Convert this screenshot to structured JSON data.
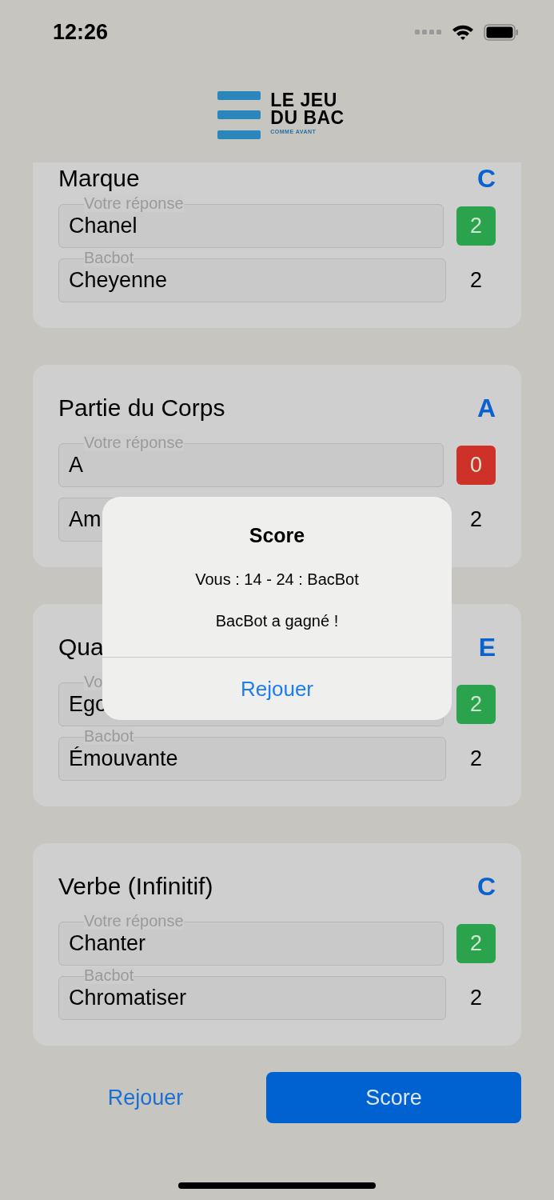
{
  "status_bar": {
    "time": "12:26"
  },
  "logo": {
    "line_1": "LE JEU",
    "line_2": "DU BAC",
    "tagline": "COMME AVANT"
  },
  "categories": [
    {
      "title": "Marque",
      "letter": "C",
      "answers": [
        {
          "label": "Votre réponse",
          "value": "Chanel",
          "score": "2",
          "color": "#2ba24c",
          "kind": "player"
        },
        {
          "label": "Bacbot",
          "value": "Cheyenne",
          "score": "2",
          "kind": "bot"
        }
      ]
    },
    {
      "title": "Partie du Corps",
      "letter": "A",
      "answers": [
        {
          "label": "Votre réponse",
          "value": "A",
          "score": "0",
          "color": "#cd3127",
          "kind": "player"
        },
        {
          "value": "Am",
          "score": "2",
          "kind": "bot"
        }
      ]
    },
    {
      "title": "Qua",
      "letter": "E",
      "answers": [
        {
          "label": "Vo",
          "value": "Ego",
          "score": "2",
          "color": "#2ba24c",
          "kind": "player"
        },
        {
          "label": "Bacbot",
          "value": "Émouvante",
          "score": "2",
          "kind": "bot"
        }
      ]
    },
    {
      "title": "Verbe (Infinitif)",
      "letter": "C",
      "answers": [
        {
          "label": "Votre réponse",
          "value": "Chanter",
          "score": "2",
          "color": "#2ba24c",
          "kind": "player"
        },
        {
          "label": "Bacbot",
          "value": "Chromatiser",
          "score": "2",
          "kind": "bot"
        }
      ]
    }
  ],
  "buttons": {
    "replay": "Rejouer",
    "score": "Score"
  },
  "dialog": {
    "title": "Score",
    "messages": [
      "Vous : 14 - 24 : BacBot",
      "BacBot a gagné !"
    ],
    "action": "Rejouer"
  }
}
